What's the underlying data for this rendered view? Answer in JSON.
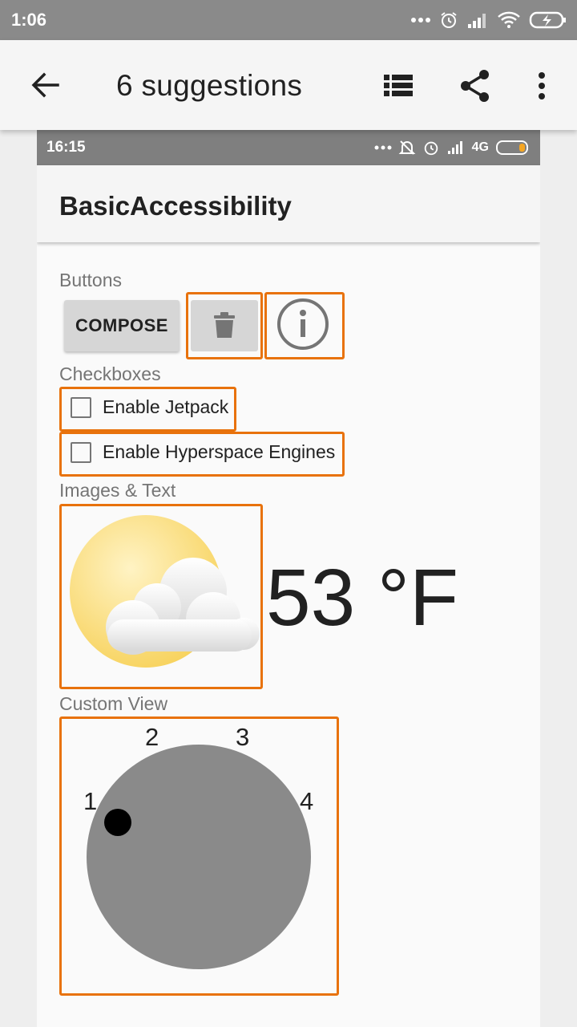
{
  "status_bar": {
    "time": "1:06"
  },
  "app_bar": {
    "title": "6 suggestions"
  },
  "inner_screen": {
    "status_bar": {
      "time": "16:15",
      "network": "4G"
    },
    "app_title": "BasicAccessibility",
    "sections": {
      "buttons": "Buttons",
      "checkboxes": "Checkboxes",
      "images_text": "Images & Text",
      "custom_view": "Custom View"
    },
    "compose_label": "COMPOSE",
    "checkboxes": [
      {
        "label": "Enable Jetpack",
        "checked": false
      },
      {
        "label": "Enable Hyperspace Engines",
        "checked": false
      }
    ],
    "temperature": "53 °F",
    "dial": {
      "labels": [
        "1",
        "2",
        "3",
        "4"
      ],
      "selected": "1"
    }
  },
  "colors": {
    "highlight": "#e8720c",
    "dial": "#8a8a8a",
    "status_bar": "#8a8a8a"
  },
  "icons": [
    "back-arrow-icon",
    "list-icon",
    "share-icon",
    "more-vert-icon",
    "trash-icon",
    "info-icon",
    "weather-partly-cloudy-icon"
  ]
}
